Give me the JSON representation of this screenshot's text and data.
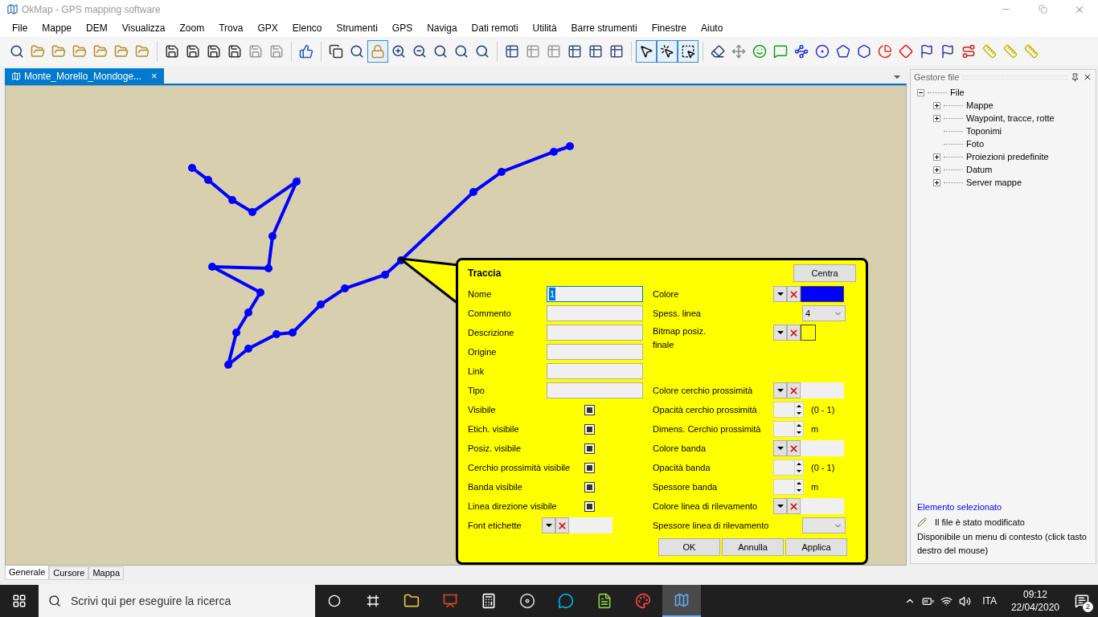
{
  "window": {
    "title": "OkMap - GPS mapping software"
  },
  "menu": [
    "File",
    "Mappe",
    "DEM",
    "Visualizza",
    "Zoom",
    "Trova",
    "GPX",
    "Elenco",
    "Strumenti",
    "GPS",
    "Naviga",
    "Dati remoti",
    "Utilità",
    "Barre strumenti",
    "Finestre",
    "Aiuto"
  ],
  "toolbar": [
    [
      {
        "selected": false
      },
      {
        "selected": false
      },
      {
        "selected": false
      },
      {
        "selected": false
      },
      {
        "selected": false
      },
      {
        "selected": false
      },
      {
        "selected": false
      }
    ],
    [
      {
        "selected": false
      },
      {
        "selected": false
      },
      {
        "selected": false
      },
      {
        "selected": false
      },
      {
        "selected": false
      },
      {
        "selected": false
      }
    ],
    [
      {
        "selected": false
      }
    ],
    [
      {
        "selected": false
      },
      {
        "selected": false
      },
      {
        "selected": true
      },
      {
        "selected": false
      },
      {
        "selected": false
      },
      {
        "selected": false
      },
      {
        "selected": false
      },
      {
        "selected": false
      }
    ],
    [
      {
        "selected": false
      },
      {
        "selected": false
      },
      {
        "selected": false
      },
      {
        "selected": false
      },
      {
        "selected": false
      },
      {
        "selected": false
      }
    ],
    [
      {
        "selected": true
      },
      {
        "selected": true
      },
      {
        "selected": true
      }
    ],
    [
      {
        "selected": false
      },
      {
        "selected": false
      },
      {
        "selected": false
      },
      {
        "selected": false
      },
      {
        "selected": false
      },
      {
        "selected": false
      },
      {
        "selected": false
      },
      {
        "selected": false
      },
      {
        "selected": false
      },
      {
        "selected": false
      },
      {
        "selected": false
      },
      {
        "selected": false
      },
      {
        "selected": false
      },
      {
        "selected": false
      },
      {
        "selected": false
      },
      {
        "selected": false
      }
    ]
  ],
  "document_tabs": [
    {
      "label": "Monte_Morello_Mondoge...",
      "close": "×",
      "selected": true
    }
  ],
  "dialog": {
    "title": "Traccia",
    "center_button": "Centra",
    "left_rows": [
      {
        "kind": "text",
        "label": "Nome",
        "value": "1"
      },
      {
        "kind": "text",
        "label": "Commento",
        "value": ""
      },
      {
        "kind": "text",
        "label": "Descrizione",
        "value": ""
      },
      {
        "kind": "text",
        "label": "Origine",
        "value": ""
      },
      {
        "kind": "text",
        "label": "Link",
        "value": ""
      },
      {
        "kind": "text",
        "label": "Tipo",
        "value": ""
      },
      {
        "kind": "checkbox",
        "label": "Visibile",
        "checked": true
      },
      {
        "kind": "checkbox",
        "label": "Etich. visibile",
        "checked": true
      },
      {
        "kind": "checkbox",
        "label": "Posiz. visibile",
        "checked": true
      },
      {
        "kind": "checkbox",
        "label": "Cerchio prossimità visibile",
        "checked": true
      },
      {
        "kind": "checkbox",
        "label": "Banda visibile",
        "checked": true
      },
      {
        "kind": "checkbox",
        "label": "Linea direzione visibile",
        "checked": true
      },
      {
        "kind": "picker",
        "label": "Font etichette"
      }
    ],
    "right_rows": [
      {
        "kind": "picker",
        "label": "Colore",
        "color": "#0000ff"
      },
      {
        "kind": "select",
        "label": "Spess. linea",
        "value": "4"
      },
      {
        "kind": "picker",
        "label": "Bitmap posiz. finale",
        "color": "#ffff00"
      },
      {
        "kind": "picker",
        "label": "Colore cerchio prossimità"
      },
      {
        "kind": "spinner",
        "label": "Opacità cerchio prossimità",
        "unit": "(0 - 1)"
      },
      {
        "kind": "spinner",
        "label": "Dimens. Cerchio prossimità",
        "unit": "m"
      },
      {
        "kind": "picker",
        "label": "Colore banda"
      },
      {
        "kind": "spinner",
        "label": "Opacità banda",
        "unit": "(0 - 1)"
      },
      {
        "kind": "spinner",
        "label": "Spessore banda",
        "unit": "m"
      },
      {
        "kind": "picker",
        "label": "Colore linea di rilevamento"
      },
      {
        "kind": "select",
        "label": "Spessore linea di rilevamento",
        "value": ""
      }
    ],
    "buttons": [
      "OK",
      "Annulla",
      "Applica"
    ]
  },
  "file_manager": {
    "title": "Gestore file",
    "tree": [
      {
        "label": "File",
        "expanded": true,
        "children": [
          {
            "label": "Mappe",
            "expanded": false
          },
          {
            "label": "Waypoint, tracce, rotte",
            "expanded": false
          },
          {
            "label": "Toponimi"
          },
          {
            "label": "Foto"
          },
          {
            "label": "Proiezioni predefinite",
            "expanded": false
          },
          {
            "label": "Datum",
            "expanded": false
          },
          {
            "label": "Server mappe",
            "expanded": false
          }
        ]
      }
    ],
    "info_title": "Elemento selezionato",
    "info_status": "Il file è stato modificato",
    "info_hint": "Disponibile un menu di contesto (click tasto destro del mouse)"
  },
  "bottom_tabs": [
    {
      "label": "Generale",
      "selected": true
    },
    {
      "label": "Cursore",
      "selected": false
    },
    {
      "label": "Mappa",
      "selected": false
    }
  ],
  "taskbar": {
    "search_placeholder": "Scrivi qui per eseguire la ricerca",
    "apps": [
      {
        "selected": false
      },
      {
        "selected": false
      },
      {
        "selected": false
      },
      {
        "selected": false
      },
      {
        "selected": false
      },
      {
        "selected": false
      },
      {
        "selected": false
      },
      {
        "selected": true
      }
    ],
    "language": "ITA",
    "time": "09:12",
    "date": "22/04/2020",
    "notifications": "2"
  }
}
